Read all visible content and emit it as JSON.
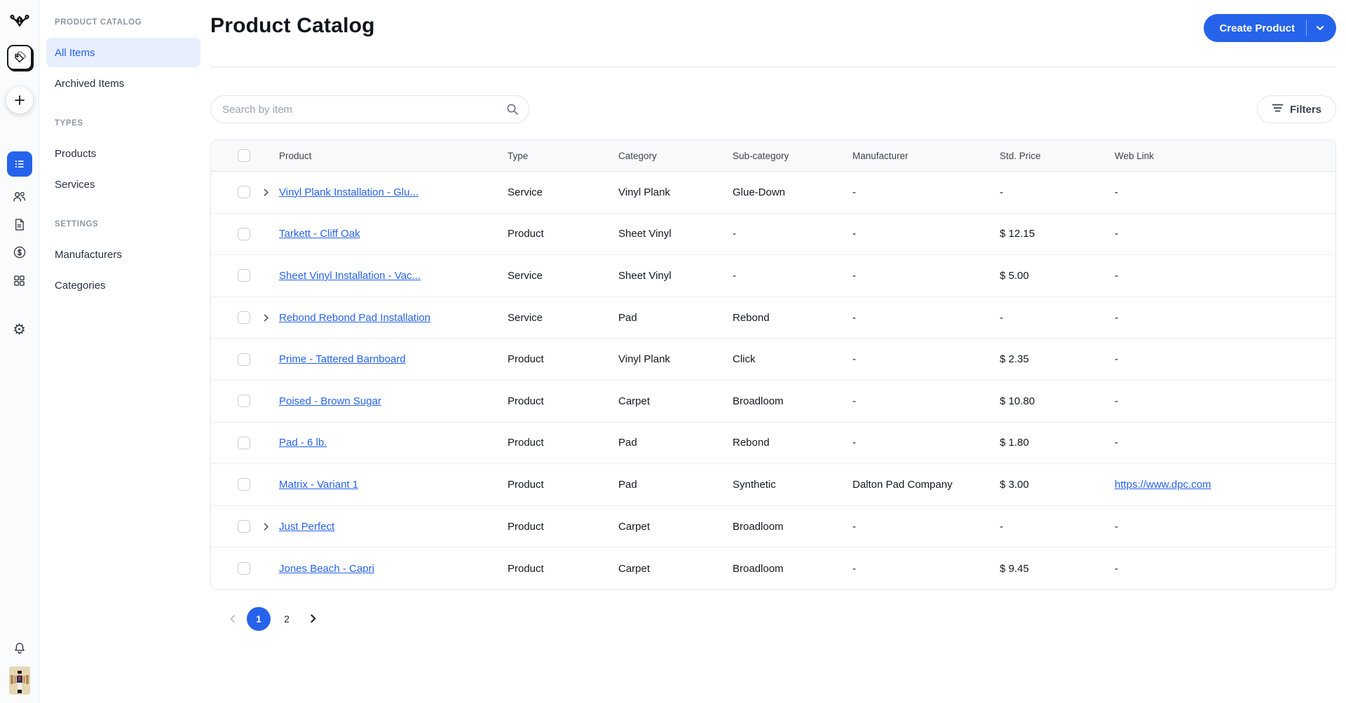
{
  "colors": {
    "accent": "#2563eb",
    "active_bg": "#e7eefc",
    "border": "#e5e7eb",
    "header_bg": "#f8f9fa"
  },
  "sidebar": {
    "title": "PRODUCT CATALOG",
    "items": [
      {
        "label": "All Items",
        "active": true
      },
      {
        "label": "Archived Items",
        "active": false
      }
    ],
    "sections": [
      {
        "label": "TYPES",
        "items": [
          {
            "label": "Products"
          },
          {
            "label": "Services"
          }
        ]
      },
      {
        "label": "SETTINGS",
        "items": [
          {
            "label": "Manufacturers"
          },
          {
            "label": "Categories"
          }
        ]
      }
    ]
  },
  "header": {
    "title": "Product Catalog",
    "create_label": "Create Product"
  },
  "toolbar": {
    "search_placeholder": "Search by item",
    "filters_label": "Filters"
  },
  "table": {
    "columns": {
      "product": "Product",
      "type": "Type",
      "category": "Category",
      "subcategory": "Sub-category",
      "manufacturer": "Manufacturer",
      "price": "Std. Price",
      "weblink": "Web Link"
    },
    "rows": [
      {
        "name": "Vinyl Plank Installation - Glu...",
        "expandable": true,
        "type": "Service",
        "category": "Vinyl Plank",
        "subcategory": "Glue-Down",
        "manufacturer": "-",
        "price": "-",
        "weblink": "-"
      },
      {
        "name": "Tarkett - Cliff Oak",
        "expandable": false,
        "type": "Product",
        "category": "Sheet Vinyl",
        "subcategory": "-",
        "manufacturer": "-",
        "price": "$ 12.15",
        "weblink": "-"
      },
      {
        "name": "Sheet Vinyl Installation - Vac...",
        "expandable": false,
        "type": "Service",
        "category": "Sheet Vinyl",
        "subcategory": "-",
        "manufacturer": "-",
        "price": "$ 5.00",
        "weblink": "-"
      },
      {
        "name": "Rebond Rebond Pad Installation",
        "expandable": true,
        "type": "Service",
        "category": "Pad",
        "subcategory": "Rebond",
        "manufacturer": "-",
        "price": "-",
        "weblink": "-"
      },
      {
        "name": "Prime - Tattered Barnboard",
        "expandable": false,
        "type": "Product",
        "category": "Vinyl Plank",
        "subcategory": "Click",
        "manufacturer": "-",
        "price": "$ 2.35",
        "weblink": "-"
      },
      {
        "name": "Poised - Brown Sugar",
        "expandable": false,
        "type": "Product",
        "category": "Carpet",
        "subcategory": "Broadloom",
        "manufacturer": "-",
        "price": "$ 10.80",
        "weblink": "-"
      },
      {
        "name": "Pad - 6 lb.",
        "expandable": false,
        "type": "Product",
        "category": "Pad",
        "subcategory": "Rebond",
        "manufacturer": "-",
        "price": "$ 1.80",
        "weblink": "-"
      },
      {
        "name": "Matrix - Variant 1",
        "expandable": false,
        "type": "Product",
        "category": "Pad",
        "subcategory": "Synthetic",
        "manufacturer": "Dalton Pad Company",
        "price": "$ 3.00",
        "weblink": "https://www.dpc.com"
      },
      {
        "name": "Just Perfect",
        "expandable": true,
        "type": "Product",
        "category": "Carpet",
        "subcategory": "Broadloom",
        "manufacturer": "-",
        "price": "-",
        "weblink": "-"
      },
      {
        "name": "Jones Beach - Capri",
        "expandable": false,
        "type": "Product",
        "category": "Carpet",
        "subcategory": "Broadloom",
        "manufacturer": "-",
        "price": "$ 9.45",
        "weblink": "-"
      }
    ]
  },
  "pagination": {
    "pages": [
      "1",
      "2"
    ],
    "current": "1"
  }
}
